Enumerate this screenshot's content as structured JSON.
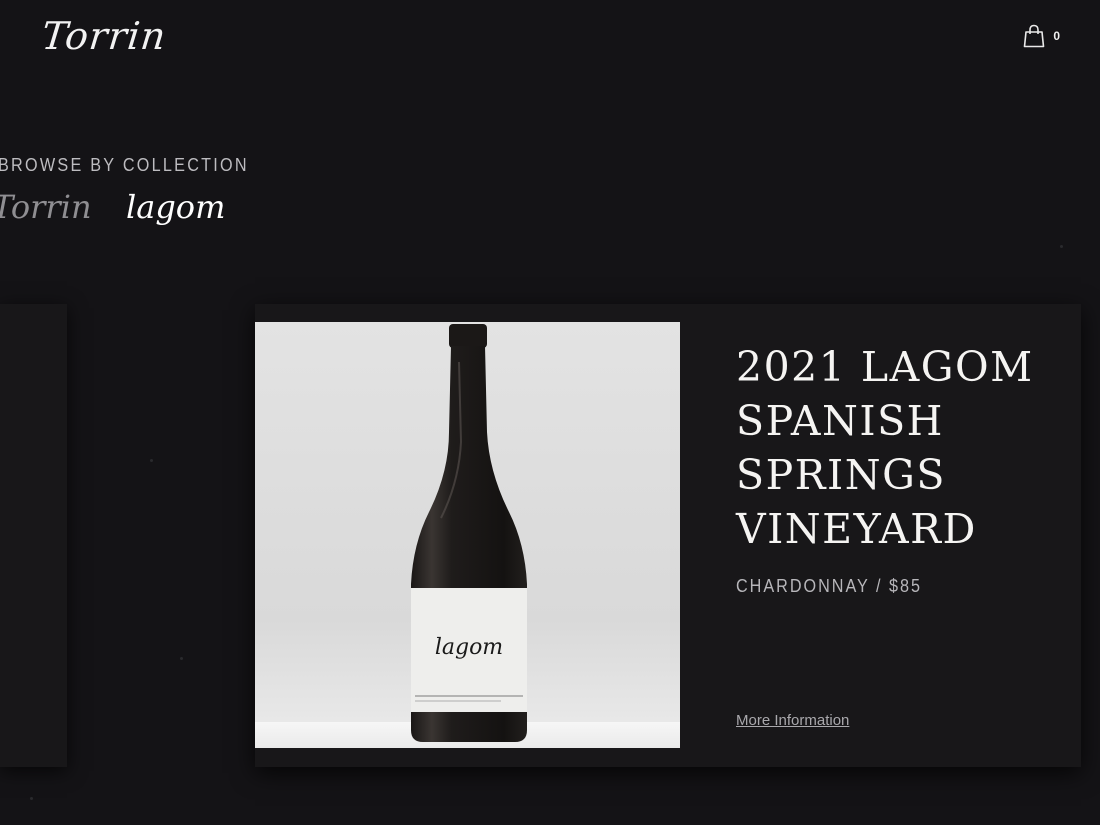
{
  "header": {
    "logo_text": "Torrin",
    "cart_icon": "shopping-bag-icon",
    "cart_count": "0"
  },
  "browse": {
    "heading": "BROWSE BY COLLECTION",
    "collections": [
      {
        "label": "Torrin",
        "active": false
      },
      {
        "label": "lagom",
        "active": true
      }
    ]
  },
  "product": {
    "title": "2021 LAGOM SPANISH SPRINGS VINEYARD",
    "meta": "CHARDONNAY / $85",
    "link_label": "More Information",
    "bottle_label_text": "lagom"
  },
  "colors": {
    "background": "#141316",
    "card": "#181719",
    "text_primary": "#f5f4f2",
    "text_muted": "#b7b6ba"
  }
}
